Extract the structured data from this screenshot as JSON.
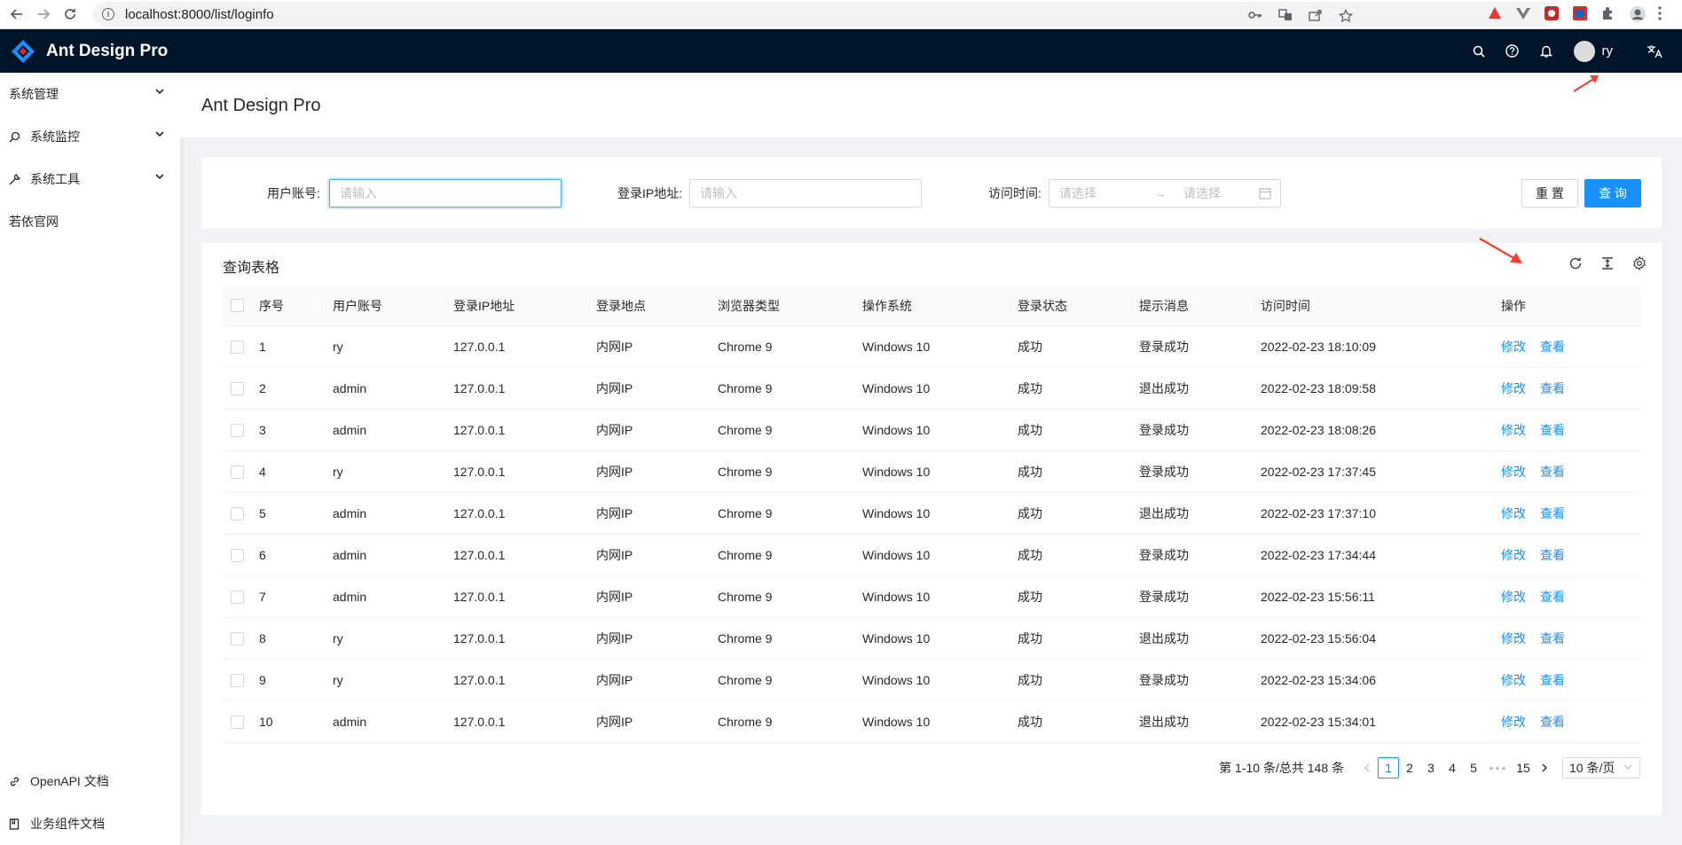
{
  "browser": {
    "url": "localhost:8000/list/loginfo"
  },
  "header": {
    "title": "Ant Design Pro",
    "username": "ry"
  },
  "sidebar": {
    "items": [
      {
        "label": "系统管理",
        "icon": "none",
        "has_children": true
      },
      {
        "label": "系统监控",
        "icon": "search-monitor-icon",
        "has_children": true
      },
      {
        "label": "系统工具",
        "icon": "tool-icon",
        "has_children": true
      },
      {
        "label": "若依官网",
        "icon": "none",
        "has_children": false
      }
    ],
    "bottom": [
      {
        "label": "OpenAPI 文档",
        "icon": "link-icon"
      },
      {
        "label": "业务组件文档",
        "icon": "book-icon"
      }
    ]
  },
  "page": {
    "title": "Ant Design Pro"
  },
  "search": {
    "user_label": "用户账号:",
    "user_placeholder": "请输入",
    "ip_label": "登录IP地址:",
    "ip_placeholder": "请输入",
    "time_label": "访问时间:",
    "time_start_placeholder": "请选择",
    "time_end_placeholder": "请选择",
    "reset_label": "重 置",
    "query_label": "查 询"
  },
  "table": {
    "title": "查询表格",
    "columns": [
      "序号",
      "用户账号",
      "登录IP地址",
      "登录地点",
      "浏览器类型",
      "操作系统",
      "登录状态",
      "提示消息",
      "访问时间",
      "操作"
    ],
    "action_edit": "修改",
    "action_view": "查看",
    "rows": [
      [
        "1",
        "ry",
        "127.0.0.1",
        "内网IP",
        "Chrome 9",
        "Windows 10",
        "成功",
        "登录成功",
        "2022-02-23 18:10:09"
      ],
      [
        "2",
        "admin",
        "127.0.0.1",
        "内网IP",
        "Chrome 9",
        "Windows 10",
        "成功",
        "退出成功",
        "2022-02-23 18:09:58"
      ],
      [
        "3",
        "admin",
        "127.0.0.1",
        "内网IP",
        "Chrome 9",
        "Windows 10",
        "成功",
        "登录成功",
        "2022-02-23 18:08:26"
      ],
      [
        "4",
        "ry",
        "127.0.0.1",
        "内网IP",
        "Chrome 9",
        "Windows 10",
        "成功",
        "登录成功",
        "2022-02-23 17:37:45"
      ],
      [
        "5",
        "admin",
        "127.0.0.1",
        "内网IP",
        "Chrome 9",
        "Windows 10",
        "成功",
        "退出成功",
        "2022-02-23 17:37:10"
      ],
      [
        "6",
        "admin",
        "127.0.0.1",
        "内网IP",
        "Chrome 9",
        "Windows 10",
        "成功",
        "登录成功",
        "2022-02-23 17:34:44"
      ],
      [
        "7",
        "admin",
        "127.0.0.1",
        "内网IP",
        "Chrome 9",
        "Windows 10",
        "成功",
        "登录成功",
        "2022-02-23 15:56:11"
      ],
      [
        "8",
        "ry",
        "127.0.0.1",
        "内网IP",
        "Chrome 9",
        "Windows 10",
        "成功",
        "退出成功",
        "2022-02-23 15:56:04"
      ],
      [
        "9",
        "ry",
        "127.0.0.1",
        "内网IP",
        "Chrome 9",
        "Windows 10",
        "成功",
        "登录成功",
        "2022-02-23 15:34:06"
      ],
      [
        "10",
        "admin",
        "127.0.0.1",
        "内网IP",
        "Chrome 9",
        "Windows 10",
        "成功",
        "退出成功",
        "2022-02-23 15:34:01"
      ]
    ]
  },
  "pagination": {
    "total_text": "第 1-10 条/总共 148 条",
    "pages": [
      "1",
      "2",
      "3",
      "4",
      "5"
    ],
    "dots": "•••",
    "last": "15",
    "current": "1",
    "page_size": "10 条/页"
  },
  "colors": {
    "primary": "#1890ff",
    "header_bg": "#001529",
    "annotation": "#ff3b30"
  }
}
